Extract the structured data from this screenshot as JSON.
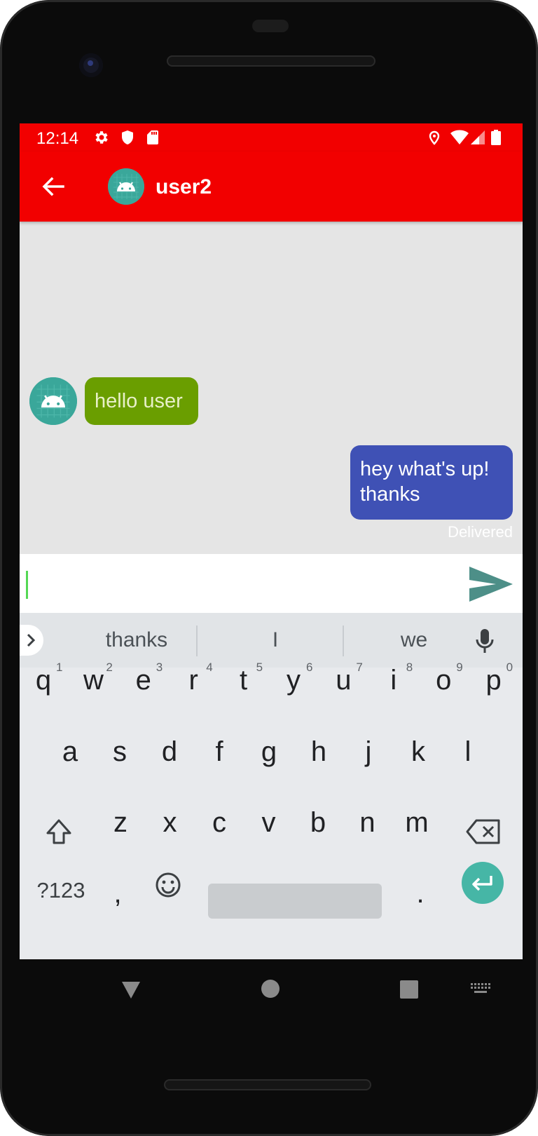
{
  "status_bar": {
    "time": "12:14",
    "left_icons": [
      "settings-gear-icon",
      "shield-icon",
      "sd-card-icon"
    ],
    "right_icons": [
      "location-icon",
      "wifi-icon",
      "cellular-signal-icon",
      "battery-icon"
    ]
  },
  "app_bar": {
    "title": "user2",
    "back_icon": "arrow-back-icon",
    "avatar_icon": "android-icon"
  },
  "messages": [
    {
      "direction": "incoming",
      "text": "hello user"
    },
    {
      "direction": "outgoing",
      "text": "hey what's up!\nthanks",
      "status": "Delivered"
    }
  ],
  "composer": {
    "value": "",
    "send_icon": "send-icon"
  },
  "keyboard": {
    "suggestions": [
      "thanks",
      "I",
      "we"
    ],
    "row1": [
      "q",
      "w",
      "e",
      "r",
      "t",
      "y",
      "u",
      "i",
      "o",
      "p"
    ],
    "row1_hints": [
      "1",
      "2",
      "3",
      "4",
      "5",
      "6",
      "7",
      "8",
      "9",
      "0"
    ],
    "row2": [
      "a",
      "s",
      "d",
      "f",
      "g",
      "h",
      "j",
      "k",
      "l"
    ],
    "row3": [
      "z",
      "x",
      "c",
      "v",
      "b",
      "n",
      "m"
    ],
    "symbols_label": "?123",
    "comma_label": ",",
    "period_label": "."
  },
  "colors": {
    "accent_red": "#f20000",
    "incoming_bubble": "#6a9e00",
    "outgoing_bubble": "#3f51b5",
    "avatar_teal": "#3aa79a",
    "send_icon": "#4d8f88",
    "enter_key": "#46b6a6"
  }
}
